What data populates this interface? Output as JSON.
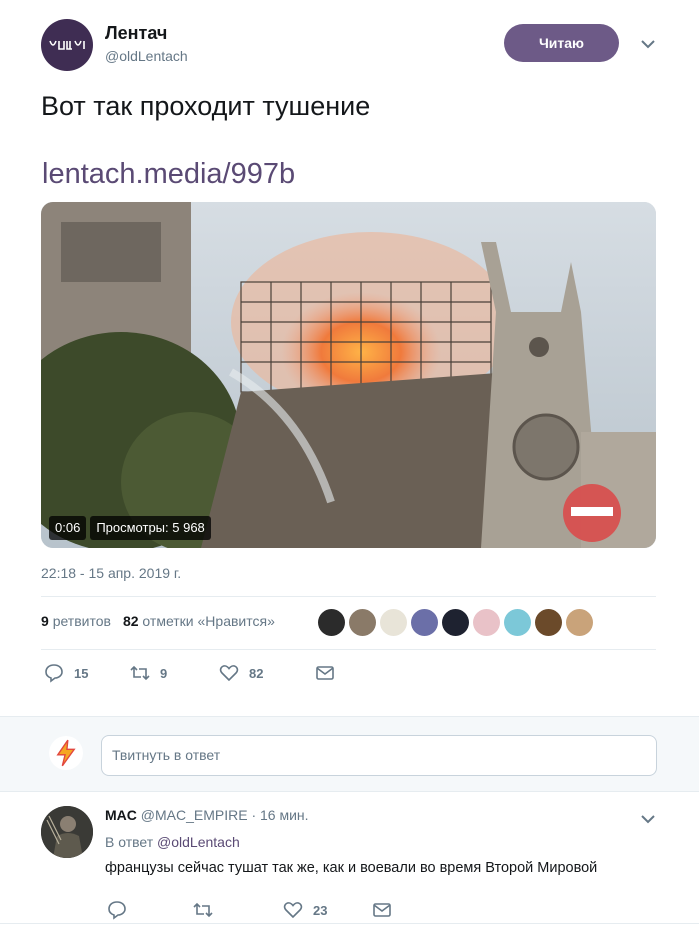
{
  "tweet": {
    "author_name": "Лентач",
    "author_handle": "@oldLentach",
    "follow_label": "Читаю",
    "text": "Вот так проходит тушение",
    "link": "lentach.media/997b",
    "video": {
      "time": "0:06",
      "views": "Просмотры: 5 968"
    },
    "timestamp": "22:18 - 15 апр. 2019 г.",
    "stats": {
      "retweets_count": "9",
      "retweets_label": "ретвитов",
      "likes_count": "82",
      "likes_label": "отметки «Нравится»"
    },
    "likers": [
      {
        "icon": "liker-avatar",
        "color": "#2b2b2b"
      },
      {
        "icon": "liker-avatar",
        "color": "#8a7a68"
      },
      {
        "icon": "liker-avatar",
        "color": "#e8e4d8"
      },
      {
        "icon": "liker-avatar",
        "color": "#6b6fa8"
      },
      {
        "icon": "liker-avatar",
        "color": "#1e2230"
      },
      {
        "icon": "liker-avatar",
        "color": "#e9c2c8"
      },
      {
        "icon": "liker-avatar",
        "color": "#7cc8d8"
      },
      {
        "icon": "liker-avatar",
        "color": "#6b4a2a"
      },
      {
        "icon": "liker-avatar",
        "color": "#c9a37a"
      }
    ],
    "actions": {
      "replies": "15",
      "retweets": "9",
      "likes": "82"
    }
  },
  "reply_box": {
    "placeholder": "Твитнуть в ответ"
  },
  "comment": {
    "name": "MAC",
    "handle": "@MAC_EMPIRE",
    "time": "· 16 мин.",
    "reply_prefix": "В ответ",
    "reply_to": "@oldLentach",
    "text": "французы сейчас тушат так же, как и воевали во время Второй Мировой",
    "likes": "23"
  },
  "colors": {
    "accent": "#6d5a87",
    "link": "#5a4a74",
    "muted": "#657786"
  }
}
